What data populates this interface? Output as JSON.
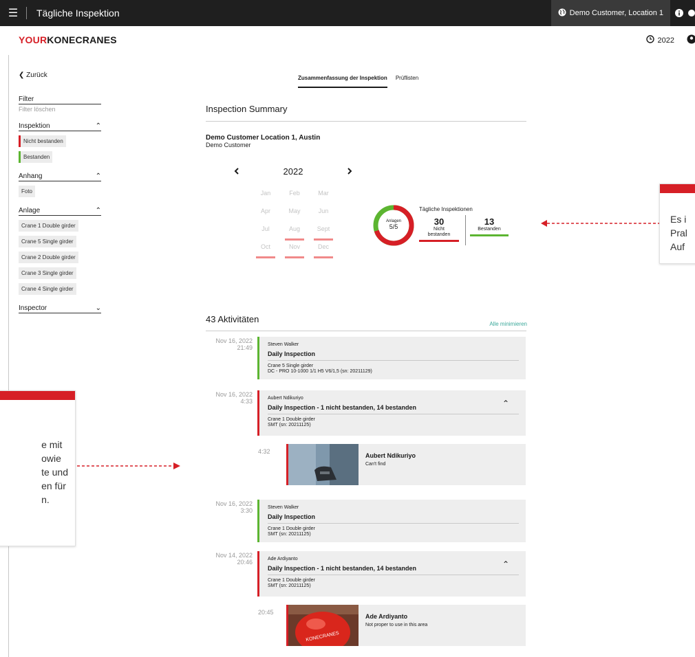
{
  "topbar": {
    "title": "Tägliche Inspektion",
    "customer": "Demo Customer, Location 1"
  },
  "brand": {
    "your": "YOUR",
    "konecranes": "KONECRANES"
  },
  "header": {
    "year": "2022"
  },
  "sidebar": {
    "back": "Zurück",
    "filter": {
      "title": "Filter",
      "clear": "Filter löschen"
    },
    "inspection": {
      "title": "Inspektion",
      "chips": [
        "Nicht bestanden",
        "Bestanden"
      ]
    },
    "attachment": {
      "title": "Anhang",
      "chips": [
        "Foto"
      ]
    },
    "asset": {
      "title": "Anlage",
      "chips": [
        "Crane 1 Double girder",
        "Crane 5 Single girder",
        "Crane 2 Double girder",
        "Crane 3 Single girder",
        "Crane 4 Single girder"
      ]
    },
    "inspector": {
      "title": "Inspector"
    }
  },
  "tabs": [
    "Zusammenfassung der Inspektion",
    "Prüflisten"
  ],
  "summary": {
    "title": "Inspection Summary",
    "location": "Demo Customer Location 1, Austin",
    "customer": "Demo Customer",
    "year": "2022",
    "months": [
      {
        "label": "Jan",
        "failed": false
      },
      {
        "label": "Feb",
        "failed": false
      },
      {
        "label": "Mar",
        "failed": false
      },
      {
        "label": "Apr",
        "failed": false
      },
      {
        "label": "May",
        "failed": false
      },
      {
        "label": "Jun",
        "failed": false
      },
      {
        "label": "Jul",
        "failed": false
      },
      {
        "label": "Aug",
        "failed": true
      },
      {
        "label": "Sept",
        "failed": true
      },
      {
        "label": "Oct",
        "failed": true
      },
      {
        "label": "Nov",
        "failed": true
      },
      {
        "label": "Dec",
        "failed": true
      }
    ],
    "donut": {
      "label": "Anlagen",
      "value": "5/5",
      "failed_fraction": 0.7,
      "passed_fraction": 0.3
    },
    "daily_title": "Tägliche Inspektionen",
    "failed": {
      "count": "30",
      "label_1": "Nicht",
      "label_2": "bestanden"
    },
    "passed": {
      "count": "13",
      "label": "Bestanden"
    },
    "colors": {
      "fail": "#d61f26",
      "pass": "#5cb531"
    }
  },
  "callout_right": {
    "lines": [
      "Es i",
      "Pral",
      "Auf"
    ]
  },
  "callout_left": {
    "lines": [
      "e mit",
      "owie",
      "te und",
      "en für",
      "n."
    ]
  },
  "activities": {
    "title": "43 Aktivitäten",
    "collapse_all": "Alle minimieren",
    "items": [
      {
        "date": "Nov 16, 2022",
        "time": "21:49",
        "by": "Steven Walker",
        "name": "Daily Inspection",
        "asset": "Crane 5 Single girder",
        "serial": "DC - PRO 10-1000 1/1 H5 V6/1,5 (sn: 20211129)"
      },
      {
        "date": "Nov 16, 2022",
        "time": "4:33",
        "by": "Aubert Ndikuriyo",
        "name": "Daily Inspection - 1 nicht bestanden, 14 bestanden",
        "asset": "Crane 1 Double girder",
        "serial": "SMT (sn: 20211125)"
      },
      {
        "date": "Nov 16, 2022",
        "time": "3:30",
        "by": "Steven Walker",
        "name": "Daily Inspection",
        "asset": "Crane 1 Double girder",
        "serial": "SMT (sn: 20211125)"
      },
      {
        "date": "Nov 14, 2022",
        "time": "20:46",
        "by": "Ade Ardiyanto",
        "name": "Daily Inspection - 1 nicht bestanden, 14 bestanden",
        "asset": "Crane 1 Double girder",
        "serial": "SMT (sn: 20211125)"
      }
    ],
    "photos": [
      {
        "time": "4:32",
        "name": "Aubert Ndikuriyo",
        "message": "Can't find"
      },
      {
        "time": "20:45",
        "name": "Ade Ardiyanto",
        "message": "Not proper to use in this area",
        "helmet_text": "KONECRANES"
      }
    ]
  }
}
